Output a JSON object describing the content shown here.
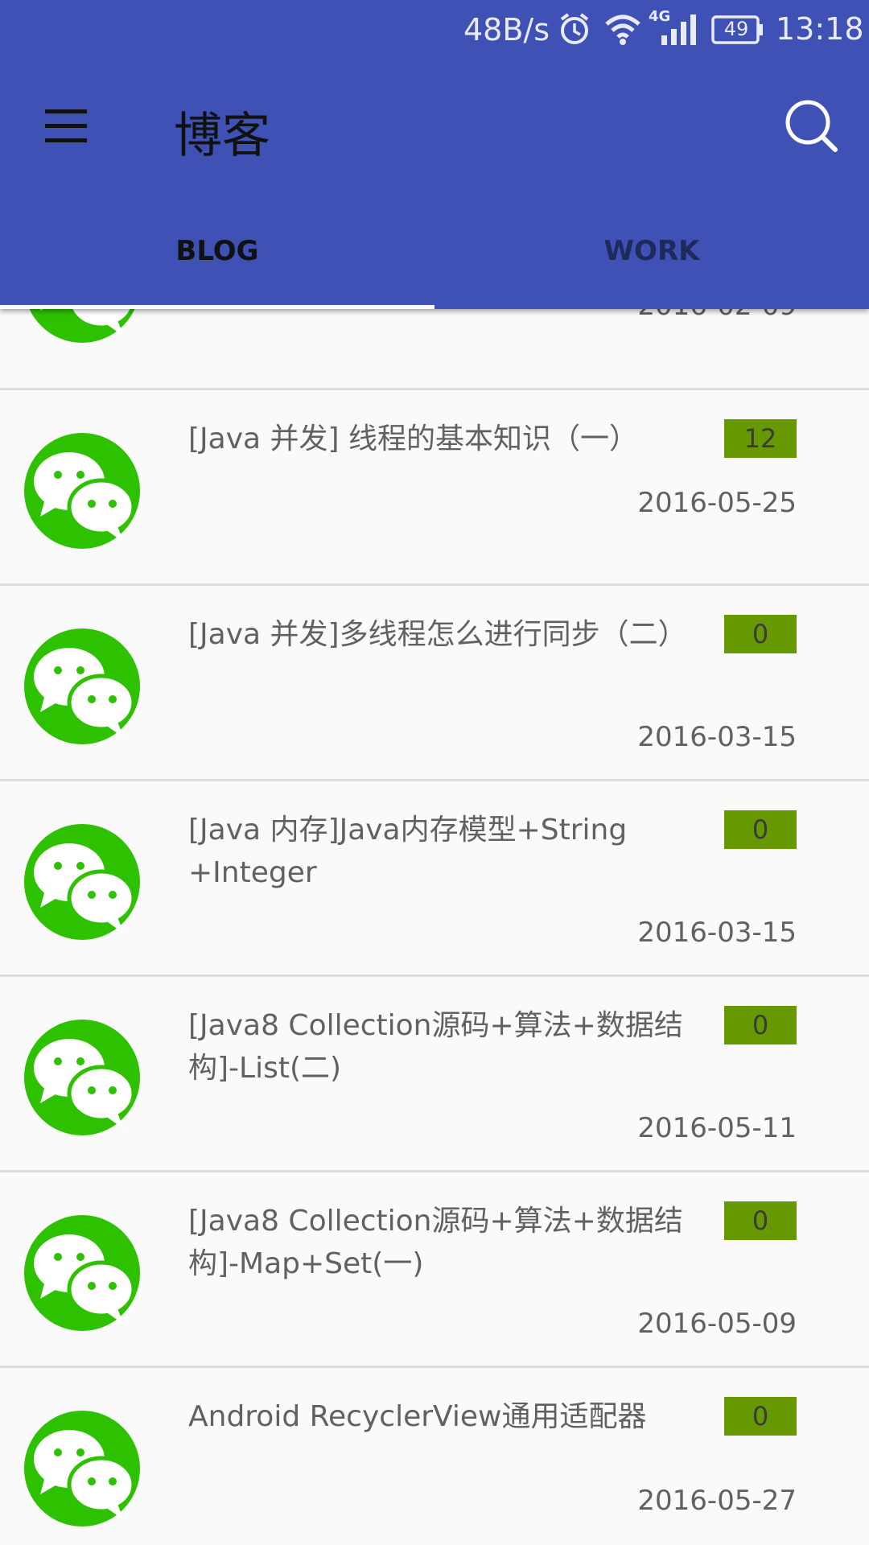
{
  "status_bar": {
    "speed": "48B/s",
    "network": "4G",
    "battery": "49",
    "time": "13:18",
    "icons": [
      "alarm-icon",
      "wifi-icon",
      "signal-icon",
      "battery-icon"
    ]
  },
  "toolbar": {
    "title": "博客",
    "menu_icon": "hamburger-menu-icon",
    "search_icon": "search-icon"
  },
  "tabs": [
    {
      "label": "BLOG",
      "selected": true
    },
    {
      "label": "WORK",
      "selected": false
    }
  ],
  "colors": {
    "primary": "#3F51B5",
    "badge": "#669900",
    "avatar": "#2DC100"
  },
  "posts": [
    {
      "title": "",
      "count": "",
      "date": "2016-02-09"
    },
    {
      "title": "[Java 并发] 线程的基本知识（一）",
      "count": "12",
      "date": "2016-05-25"
    },
    {
      "title": "[Java 并发]多线程怎么进行同步（二）",
      "count": "0",
      "date": "2016-03-15"
    },
    {
      "title": "[Java 内存]Java内存模型+String +Integer",
      "count": "0",
      "date": "2016-03-15"
    },
    {
      "title": "[Java8 Collection源码+算法+数据结构]-List(二)",
      "count": "0",
      "date": "2016-05-11"
    },
    {
      "title": "[Java8 Collection源码+算法+数据结构]-Map+Set(一)",
      "count": "0",
      "date": "2016-05-09"
    },
    {
      "title": "Android RecyclerView通用适配器",
      "count": "0",
      "date": "2016-05-27"
    }
  ]
}
